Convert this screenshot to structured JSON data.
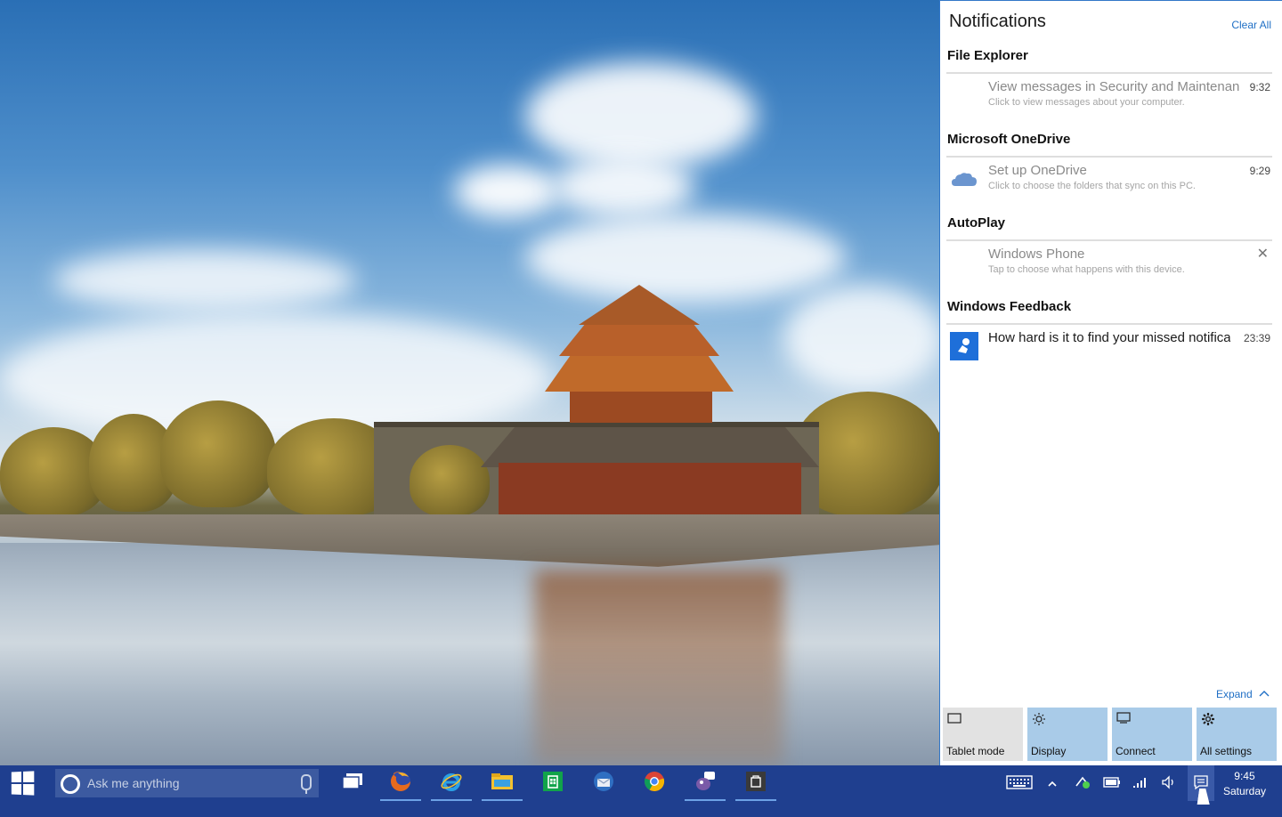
{
  "action_center": {
    "title": "Notifications",
    "clear_all": "Clear All",
    "groups": [
      {
        "app": "File Explorer",
        "icon": "shield-icon",
        "title": "View messages in Security and Maintenance",
        "subtitle": "Click to view messages about your computer.",
        "time": "9:32"
      },
      {
        "app": "Microsoft OneDrive",
        "icon": "cloud-icon",
        "title": "Set up OneDrive",
        "subtitle": "Click to choose the folders that sync on this PC.",
        "time": "9:29"
      },
      {
        "app": "AutoPlay",
        "icon": "phone-icon",
        "title": "Windows Phone",
        "subtitle": "Tap to choose what happens with this device.",
        "close": "✕"
      },
      {
        "app": "Windows Feedback",
        "icon": "feedback-icon",
        "title": "How hard is it to find your missed notifications?",
        "subtitle": "",
        "time": "23:39"
      }
    ],
    "expand": "Expand",
    "quick_actions": [
      {
        "label": "Tablet mode",
        "icon": "tablet-icon",
        "state": "off"
      },
      {
        "label": "Display",
        "icon": "brightness-icon",
        "state": "on"
      },
      {
        "label": "Connect",
        "icon": "connect-icon",
        "state": "on"
      },
      {
        "label": "All settings",
        "icon": "gear-icon",
        "state": "on"
      }
    ]
  },
  "taskbar": {
    "search_placeholder": "Ask me anything",
    "apps": [
      "task-view",
      "firefox",
      "internet-explorer",
      "file-explorer",
      "store",
      "thunderbird",
      "chrome",
      "pidgin",
      "store-window"
    ],
    "clock_time": "9:45",
    "clock_day": "Saturday"
  },
  "colors": {
    "accent": "#1f6fc5",
    "taskbar": "#1f3f8f",
    "quick_action_on": "#a9cbe8",
    "quick_action_off": "#e2e2e2"
  }
}
